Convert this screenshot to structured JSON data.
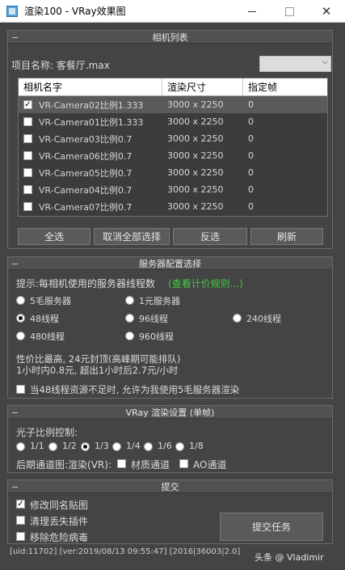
{
  "window": {
    "title": "渲染100 - VRay效果图",
    "close_glyph": "✕"
  },
  "camera_panel": {
    "title": "相机列表",
    "project_label": "项目名称: 客餐厅.max",
    "columns": [
      "相机名字",
      "渲染尺寸",
      "指定帧"
    ],
    "rows": [
      {
        "checked": true,
        "name": "VR-Camera02比例1.333",
        "size": "3000 x 2250",
        "frame": "0"
      },
      {
        "checked": false,
        "name": "VR-Camera01比例1.333",
        "size": "3000 x 2250",
        "frame": "0"
      },
      {
        "checked": false,
        "name": "VR-Camera03比例0.7",
        "size": "3000 x 2250",
        "frame": "0"
      },
      {
        "checked": false,
        "name": "VR-Camera06比例0.7",
        "size": "3000 x 2250",
        "frame": "0"
      },
      {
        "checked": false,
        "name": "VR-Camera05比例0.7",
        "size": "3000 x 2250",
        "frame": "0"
      },
      {
        "checked": false,
        "name": "VR-Camera04比例0.7",
        "size": "3000 x 2250",
        "frame": "0"
      },
      {
        "checked": false,
        "name": "VR-Camera07比例0.7",
        "size": "3000 x 2250",
        "frame": "0"
      }
    ],
    "buttons": {
      "select_all": "全选",
      "deselect_all": "取消全部选择",
      "invert": "反选",
      "refresh": "刷新"
    }
  },
  "server_panel": {
    "title": "服务器配置选择",
    "hint": "提示:每相机使用的服务器线程数",
    "pricing_link": "(查看计价规则...)",
    "options": {
      "s5": "5毛服务器",
      "s1": "1元服务器",
      "t48": "48线程",
      "t96": "96线程",
      "t240": "240线程",
      "t480": "480线程",
      "t960": "960线程"
    },
    "selected": "t48",
    "price_line1": "性价比最高, 24元封顶(高峰期可能排队)",
    "price_line2": "1小时内0.8元, 超出1小时后2.7元/小时",
    "fallback_label": "当48线程资源不足时, 允许为我使用5毛服务器渲染"
  },
  "vray_panel": {
    "title": "VRay 渲染设置 (单帧)",
    "photon_label": "光子比例控制:",
    "ratios": [
      "1/1",
      "1/2",
      "1/3",
      "1/4",
      "1/6",
      "1/8"
    ],
    "selected_ratio": "1/3",
    "post_label": "后期通道图:渲染(VR):",
    "material_channel": "材质通道",
    "ao_channel": "AO通道"
  },
  "submit_panel": {
    "title": "提交",
    "opt_modify": "修改同名贴图",
    "opt_clean": "清理丢失插件",
    "opt_remove": "移除危险病毒",
    "submit_button": "提交任务"
  },
  "footer": {
    "status": "[uid:11702] [ver:2019/08/13 09:55:47] [2016|36003|2.0]"
  },
  "watermark": "头条 @    Vladimir"
}
